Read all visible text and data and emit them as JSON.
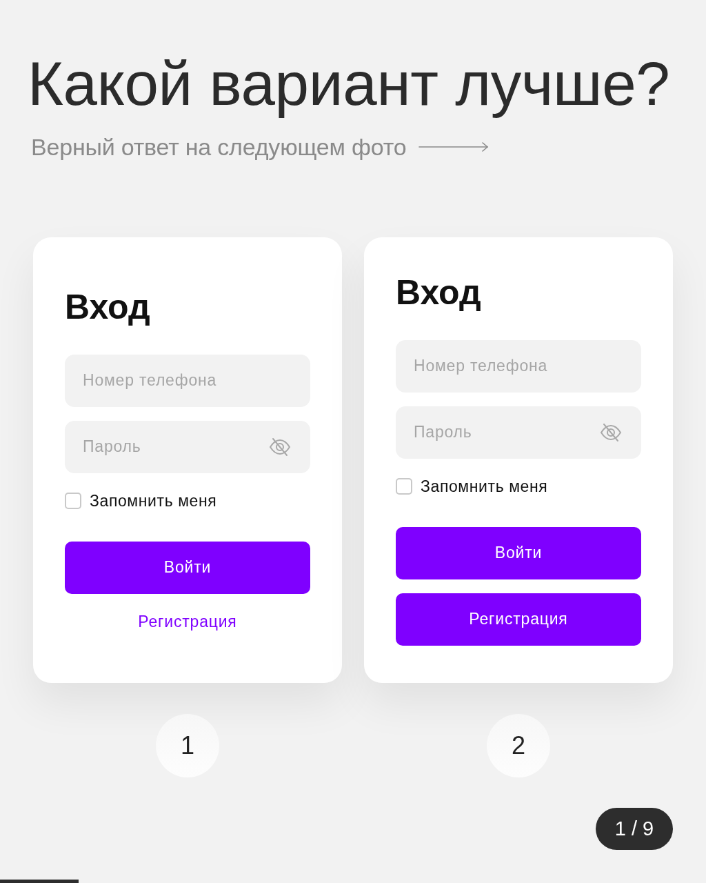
{
  "heading": {
    "title": "Какой вариант лучше?",
    "subtitle": "Верный ответ на следующем фото"
  },
  "variants": [
    {
      "title": "Вход",
      "fields": [
        {
          "kind": "tel",
          "placeholder": "Номер телефона"
        },
        {
          "kind": "password",
          "placeholder": "Пароль"
        }
      ],
      "remember": {
        "label": "Запомнить меня",
        "checked": false
      },
      "submit": "Войти",
      "register": {
        "kind": "link",
        "label": "Регистрация"
      },
      "number": "1"
    },
    {
      "title": "Вход",
      "fields": [
        {
          "kind": "tel",
          "placeholder": "Номер телефона"
        },
        {
          "kind": "password",
          "placeholder": "Пароль"
        }
      ],
      "remember": {
        "label": "Запомнить меня",
        "checked": false
      },
      "submit": "Войти",
      "register": {
        "kind": "button",
        "label": "Регистрация"
      },
      "number": "2"
    }
  ],
  "pager": {
    "label": "1 / 9",
    "level": 0.111
  }
}
